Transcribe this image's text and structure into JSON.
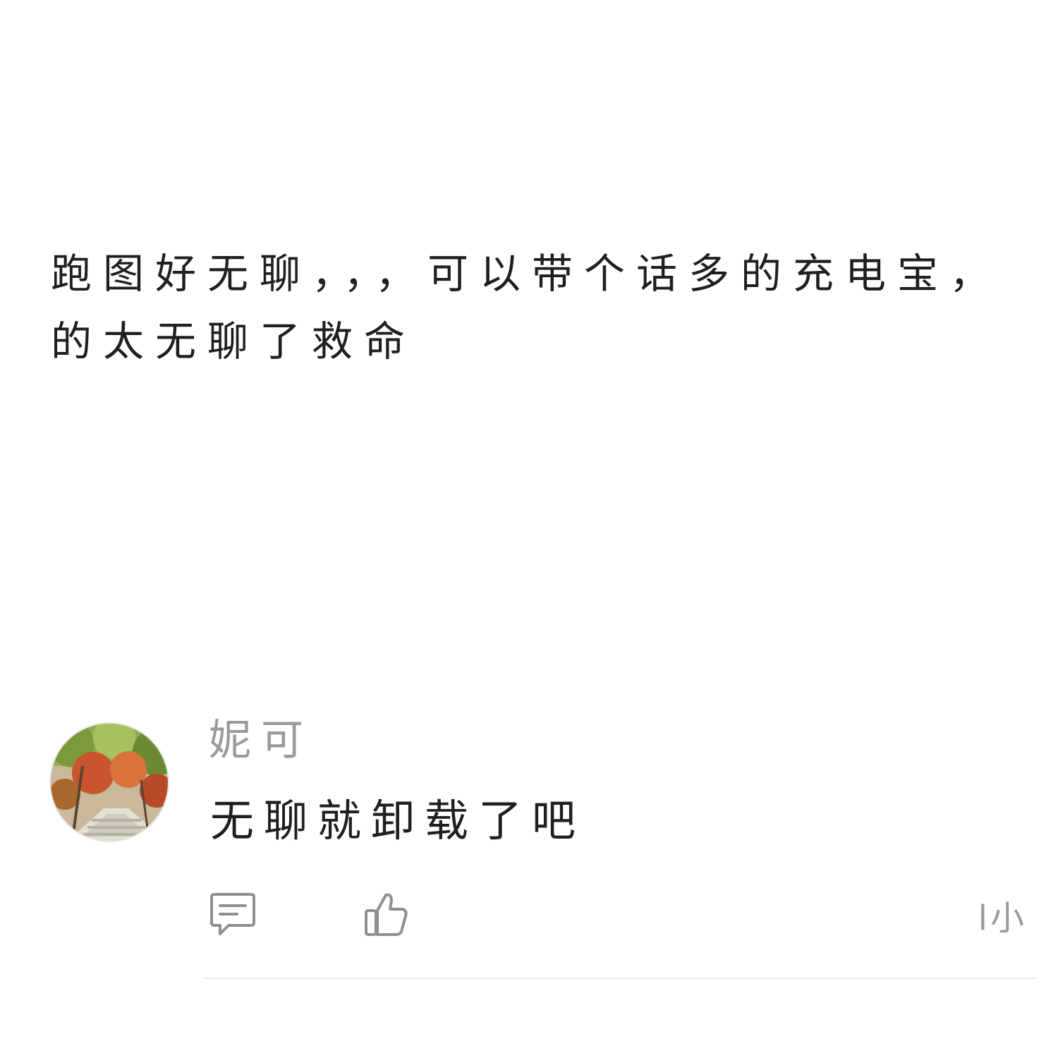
{
  "post": {
    "text": "跑图好无聊，，，可以带个话多的充电宝，的太无聊了救命"
  },
  "comment": {
    "avatar_icon": "landscape-photo-avatar",
    "username": "妮可",
    "text": "无聊就卸载了吧",
    "actions": {
      "reply_icon": "comment-bubble-icon",
      "like_icon": "thumbs-up-icon",
      "more_label": "l小"
    }
  },
  "colors": {
    "text": "#1f1f1f",
    "muted": "#9a9a9a",
    "icon": "#8f8f8f",
    "divider": "#ebebeb"
  }
}
